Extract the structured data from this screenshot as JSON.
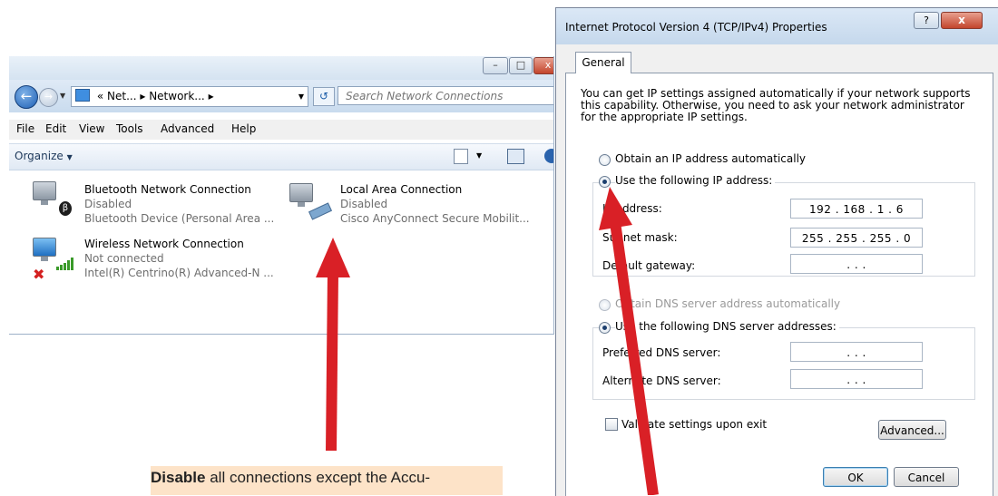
{
  "network_window": {
    "breadcrumb_prefix": "«",
    "breadcrumb": [
      "Net...",
      "Network..."
    ],
    "search_placeholder": "Search Network Connections",
    "menu": [
      "File",
      "Edit",
      "View",
      "Tools",
      "Advanced",
      "Help"
    ],
    "organize_label": "Organize",
    "connections": [
      {
        "name": "Bluetooth Network Connection",
        "status": "Disabled",
        "device": "Bluetooth Device (Personal Area ..."
      },
      {
        "name": "Local Area Connection",
        "status": "Disabled",
        "device": "Cisco AnyConnect Secure Mobilit..."
      },
      {
        "name": "Wireless Network Connection",
        "status": "Not connected",
        "device": "Intel(R) Centrino(R) Advanced-N ..."
      }
    ]
  },
  "dialog": {
    "title": "Internet Protocol Version 4 (TCP/IPv4) Properties",
    "help_label": "?",
    "close_label": "x",
    "tab_general": "General",
    "intro": "You can get IP settings assigned automatically if your network supports this capability. Otherwise, you need to ask your network administrator for the appropriate IP settings.",
    "radio_auto_ip": "Obtain an IP address automatically",
    "radio_manual_ip": "Use the following IP address:",
    "ip_address_label": "IP address:",
    "ip_address_value": "192 . 168 .  1  .  6",
    "subnet_label": "Subnet mask:",
    "subnet_value": "255 . 255 . 255 .  0",
    "gateway_label": "Default gateway:",
    "gateway_value": ".       .       .",
    "radio_auto_dns": "Obtain DNS server address automatically",
    "radio_manual_dns": "Use the following DNS server addresses:",
    "preferred_dns_label": "Preferred DNS server:",
    "preferred_dns_value": ".       .       .",
    "alternate_dns_label": "Alternate DNS server:",
    "alternate_dns_value": ".       .       .",
    "validate_label": "Validate settings upon exit",
    "advanced_label": "Advanced...",
    "ok_label": "OK",
    "cancel_label": "Cancel"
  },
  "annotation": {
    "caption_bold": "Disable",
    "caption_rest": " all connections except the Accu-",
    "arrow_color": "#d92026"
  }
}
